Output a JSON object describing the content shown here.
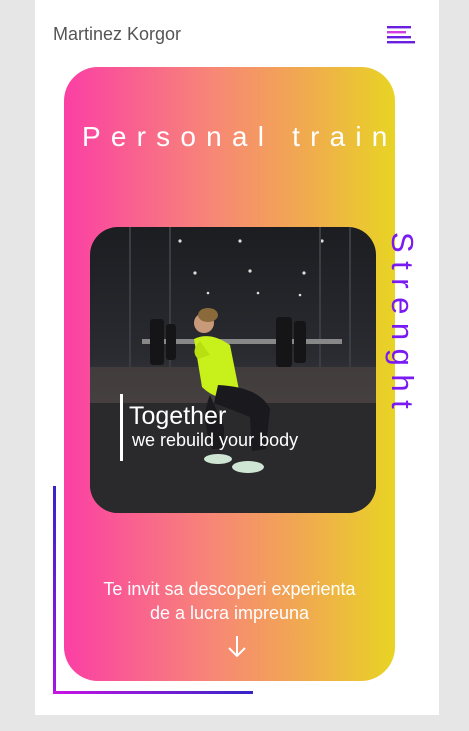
{
  "header": {
    "brand": "Martinez Korgor",
    "menu_icon": "hamburger-menu-icon"
  },
  "hero": {
    "title": "Personal trainer",
    "vertical_word": "Strenght",
    "tagline_main": "Together",
    "tagline_sub": "we rebuild your body",
    "photo_icon": "woman-squat-barbell-photo",
    "intro_line1": "Te invit sa descoperi experienta",
    "intro_line2": "de a lucra impreuna",
    "scroll_icon": "arrow-down-icon"
  },
  "colors": {
    "background": "#e6e6e6",
    "page": "#ffffff",
    "brand_text": "#555555",
    "gradient_start": "#fb3fa5",
    "gradient_end": "#e8d424",
    "accent_purple": "#7a1af2",
    "menu_icon": "#6a1fe0"
  }
}
